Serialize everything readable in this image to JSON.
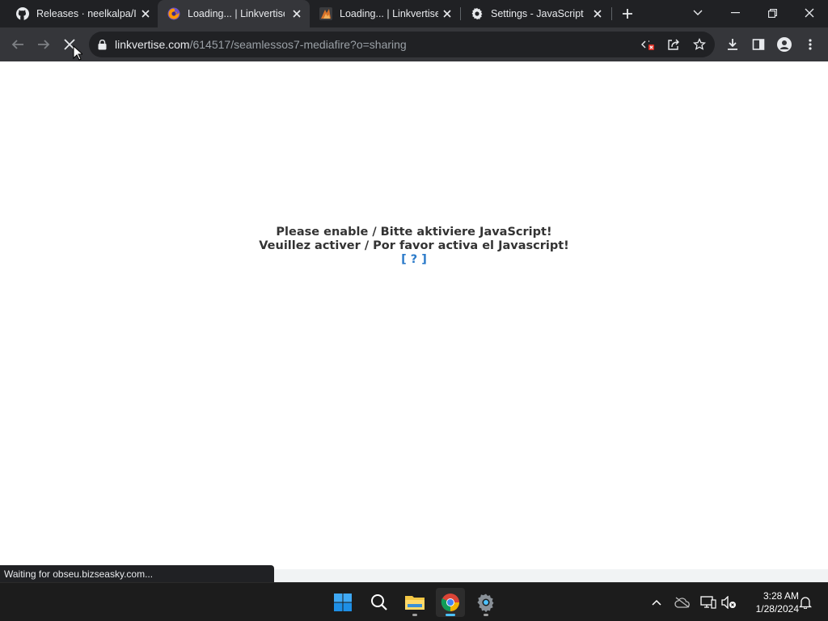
{
  "tabs": [
    {
      "title": "Releases · neelkalpa/In",
      "favicon": "github-icon",
      "active": false
    },
    {
      "title": "Loading... | Linkvertise",
      "favicon": "firefox-icon",
      "active": true
    },
    {
      "title": "Loading... | Linkvertise",
      "favicon": "linkvertise-icon",
      "active": false
    },
    {
      "title": "Settings - JavaScript",
      "favicon": "gear-icon",
      "active": false
    }
  ],
  "address_bar": {
    "host": "linkvertise.com",
    "path": "/614517/seamlessos7-mediafire?o=sharing"
  },
  "page": {
    "line1": "Please enable / Bitte aktiviere JavaScript!",
    "line2": "Veuillez activer / Por favor activa el Javascript!",
    "help_link": "[ ? ]"
  },
  "status_bar": "Waiting for obseu.bizseasky.com...",
  "taskbar": {
    "apps": [
      "windows-start-icon",
      "search-icon",
      "file-explorer-icon",
      "chrome-icon",
      "settings-icon"
    ],
    "time": "3:28 AM",
    "date": "1/28/2024"
  },
  "colors": {
    "tabstrip": "#202124",
    "toolbar": "#35363a",
    "link": "#2a7ac9",
    "text": "#333333",
    "taskbar": "#1c1c1c",
    "accent": "#4cc2ff"
  }
}
